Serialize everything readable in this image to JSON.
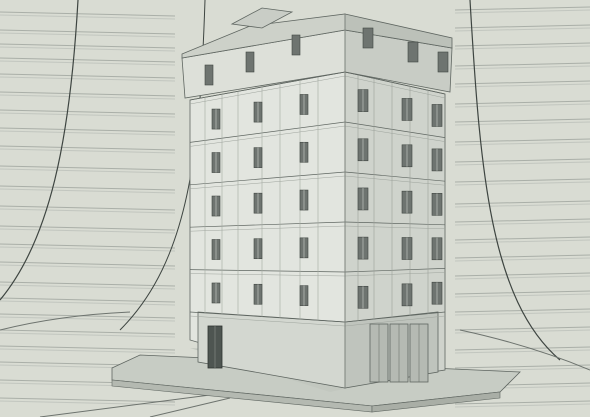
{
  "scene": {
    "kind": "3d-render",
    "subject": "apartment-building-model",
    "colors": {
      "background": "#d9dcd3",
      "wall_light": "#e2e5df",
      "wall_side": "#cfd3cc",
      "wall_shadow": "#bfc4bd",
      "roof": "#cdd1c9",
      "window": "#6e7470",
      "line": "#5f6661",
      "ground": "#cfd3cb",
      "slab": "#c7ccc4"
    },
    "floors_main": 5,
    "floors_attic": 1
  }
}
